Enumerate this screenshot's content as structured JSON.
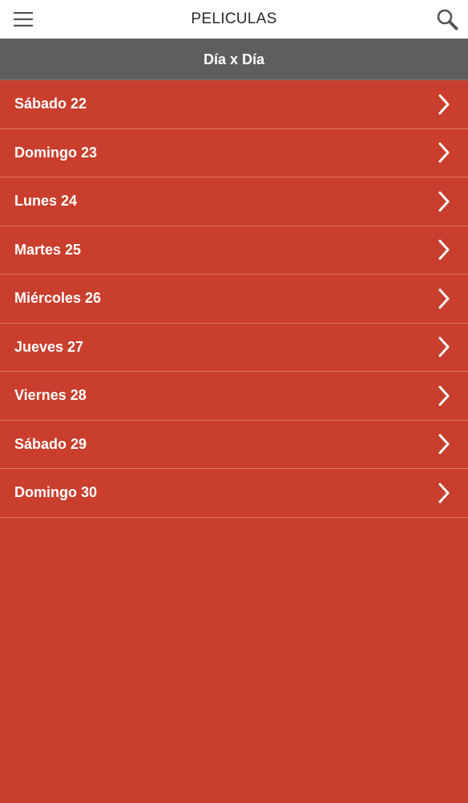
{
  "header": {
    "title": "PELICULAS",
    "menu_icon": "hamburger-menu-icon",
    "search_icon": "search-icon"
  },
  "section": {
    "title": "Día x Día"
  },
  "days": [
    {
      "label": "Sábado 22"
    },
    {
      "label": "Domingo 23"
    },
    {
      "label": "Lunes 24"
    },
    {
      "label": "Martes 25"
    },
    {
      "label": "Miércoles 26"
    },
    {
      "label": "Jueves 27"
    },
    {
      "label": "Viernes 28"
    },
    {
      "label": "Sábado 29"
    },
    {
      "label": "Domingo 30"
    }
  ],
  "colors": {
    "background": "#C93E2D",
    "header_bg": "#FFFFFF",
    "section_bg": "#5E5E60",
    "divider": "#DC7667",
    "text_light": "#FFFFFF",
    "text_dark": "#2B2B2B"
  }
}
